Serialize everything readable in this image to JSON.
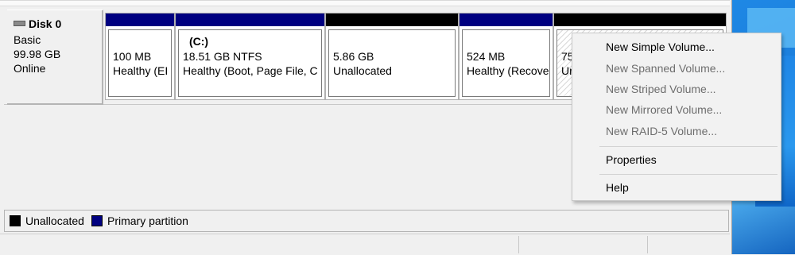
{
  "colors": {
    "primary_partition": "#000080",
    "unallocated": "#000000",
    "menu_disabled_text": "#6d6d6d"
  },
  "disk": {
    "icon": "disk-drive-icon",
    "name": "Disk 0",
    "type": "Basic",
    "size": "99.98 GB",
    "status": "Online"
  },
  "partitions": [
    {
      "size": "100 MB",
      "status": "Healthy (EI",
      "kind": "primary"
    },
    {
      "label": "(C:)",
      "size": "18.51 GB NTFS",
      "status": "Healthy (Boot, Page File, C",
      "kind": "primary"
    },
    {
      "size": "5.86 GB",
      "status": "Unallocated",
      "kind": "unallocated"
    },
    {
      "size": "524 MB",
      "status": "Healthy (Recove",
      "kind": "primary"
    },
    {
      "size": "75",
      "status": "Ur",
      "kind": "unallocated"
    }
  ],
  "legend": {
    "unallocated": "Unallocated",
    "primary": "Primary partition"
  },
  "context_menu": {
    "items": [
      {
        "label": "New Simple Volume...",
        "enabled": true
      },
      {
        "label": "New Spanned Volume...",
        "enabled": false
      },
      {
        "label": "New Striped Volume...",
        "enabled": false
      },
      {
        "label": "New Mirrored Volume...",
        "enabled": false
      },
      {
        "label": "New RAID-5 Volume...",
        "enabled": false
      },
      {
        "label": "Properties",
        "enabled": true
      },
      {
        "label": "Help",
        "enabled": true
      }
    ]
  }
}
